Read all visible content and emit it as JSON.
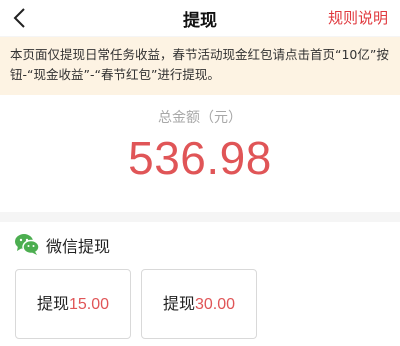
{
  "header": {
    "title": "提现",
    "rules_link": "规则说明"
  },
  "notice": {
    "text": "本页面仅提现日常任务收益，春节活动现金红包请点击首页“10亿”按钮-“现金收益”-“春节红包”进行提现。"
  },
  "summary": {
    "label": "总金额（元）",
    "amount": "536.98"
  },
  "withdraw": {
    "method_icon": "wechat-icon",
    "method_label": "微信提现",
    "options": [
      {
        "label": "提现",
        "value": "15.00"
      },
      {
        "label": "提现",
        "value": "30.00"
      }
    ]
  },
  "colors": {
    "accent": "#e05557",
    "notice_bg": "#fdf3e3",
    "wechat_green": "#4cae50"
  }
}
